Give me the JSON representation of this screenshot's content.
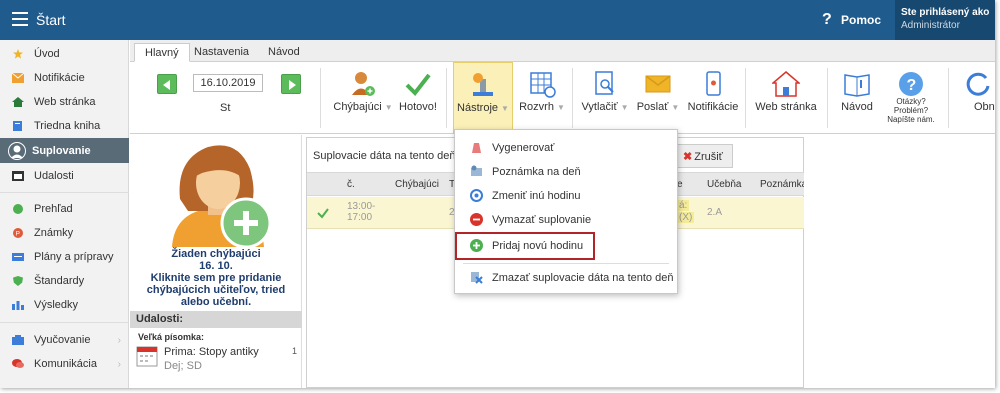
{
  "topbar": {
    "app_title": "Štart",
    "help_icon": "question-icon",
    "help_label": "Pomoc",
    "user_line1": "Ste prihlásený ako",
    "user_line2": "Administrátor",
    "color": "#1f5b8c"
  },
  "sidebar": {
    "items": [
      {
        "label": "Úvod",
        "icon": "star-icon",
        "color": "#f0b429"
      },
      {
        "label": "Notifikácie",
        "icon": "envelope-icon",
        "color": "#f0a030"
      },
      {
        "label": "Web stránka",
        "icon": "home-icon",
        "color": "#2a7a3a"
      },
      {
        "label": "Triedna kniha",
        "icon": "book-icon",
        "color": "#3b7dd8"
      },
      {
        "label": "Suplovanie",
        "icon": "person-icon",
        "color": "#ffffff"
      },
      {
        "label": "Udalosti",
        "icon": "calendar-icon",
        "color": "#333333"
      },
      {
        "label": "Prehľad",
        "icon": "check-circle-icon",
        "color": "#4caf50"
      },
      {
        "label": "Známky",
        "icon": "grade-icon",
        "color": "#e05a3a"
      },
      {
        "label": "Plány a prípravy",
        "icon": "plan-icon",
        "color": "#3b7dd8"
      },
      {
        "label": "Štandardy",
        "icon": "shield-icon",
        "color": "#4caf50"
      },
      {
        "label": "Výsledky",
        "icon": "bar-chart-icon",
        "color": "#3b7dd8"
      },
      {
        "label": "Vyučovanie",
        "icon": "teaching-icon",
        "color": "#3b7dd8"
      },
      {
        "label": "Komunikácia",
        "icon": "chat-icon",
        "color": "#d9342b"
      }
    ]
  },
  "tabs": [
    {
      "label": "Hlavný"
    },
    {
      "label": "Nastavenia"
    },
    {
      "label": "Návod"
    }
  ],
  "toolbar": {
    "date_value": "16.10.2019",
    "weekday": "St",
    "buttons": {
      "absent": "Chýbajúci",
      "done": "Hotovo!",
      "tools": "Nástroje",
      "schedule": "Rozvrh",
      "print": "Vytlačiť",
      "send": "Poslať",
      "notifications": "Notifikácie",
      "website": "Web stránka",
      "manual": "Návod",
      "question_1": "Otázky?",
      "question_2": "Problém?",
      "question_3": "Napíšte nám.",
      "refresh": "Obno"
    }
  },
  "absent_panel": {
    "line1": "Žiaden chýbajúci",
    "line2": "16. 10.",
    "line3": "Kliknite sem pre pridanie",
    "line4": "chýbajúcich učiteľov, tried",
    "line5": "alebo učební.",
    "events_header": "Udalosti:",
    "event_category": "Veľká písomka:",
    "event_name": "Prima: Stopy antiky",
    "event_sub": "Dej; SD",
    "event_count": "1"
  },
  "substitution": {
    "title": "Suplovacie dáta na tento deň e",
    "cancel_label": "Zrušiť",
    "columns": [
      "č.",
      "Chýbajúci",
      "T",
      "e",
      "Učebňa",
      "Poznámka"
    ],
    "row": {
      "time": "13:00-",
      "time2": "17:00",
      "col3": "2",
      "extra1": "á:",
      "extra2": "(X)",
      "room": "2.A"
    }
  },
  "tools_menu": {
    "items": [
      {
        "label": "Vygenerovať",
        "icon": "generate-icon"
      },
      {
        "label": "Poznámka na deň",
        "icon": "note-icon"
      },
      {
        "label": "Zmeniť inú hodinu",
        "icon": "change-icon"
      },
      {
        "label": "Vymazať suplovanie",
        "icon": "delete-icon"
      },
      {
        "label": "Pridaj novú hodinu",
        "icon": "add-icon"
      },
      {
        "label": "Zmazať suplovacie dáta na tento deň",
        "icon": "erase-icon"
      }
    ],
    "highlight_color": "#b0242a"
  }
}
